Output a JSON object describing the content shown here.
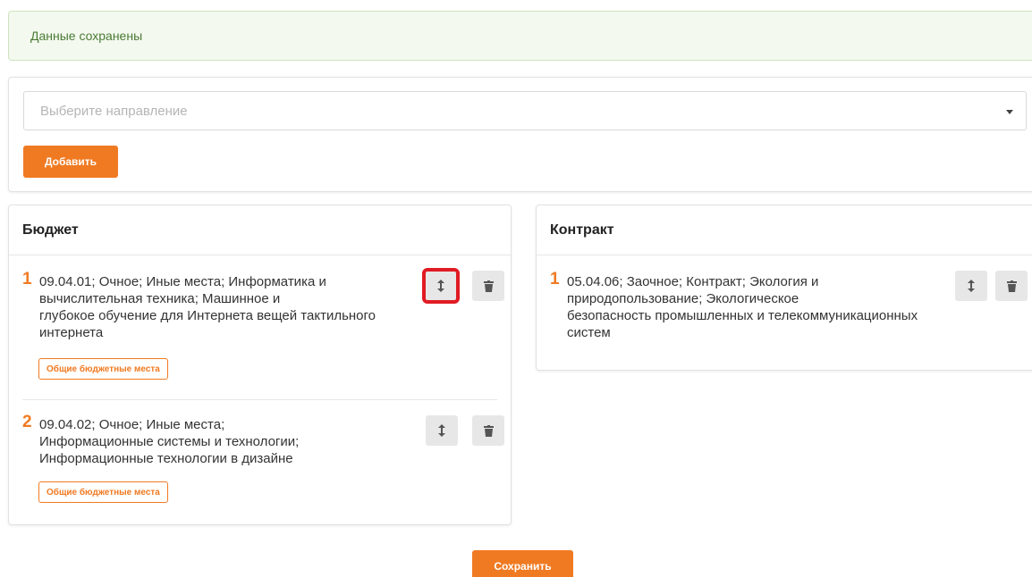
{
  "alert": {
    "text": "Данные сохранены"
  },
  "direction_select": {
    "placeholder": "Выберите направление"
  },
  "add_button": {
    "label": "Добавить"
  },
  "budget": {
    "title": "Бюджет",
    "items": [
      {
        "number": "1",
        "lines": [
          "09.04.01; Очное; Иные места; Информатика и",
          "вычислительная техника; Машинное и",
          "глубокое обучение для Интернета вещей тактильного",
          "интернета"
        ],
        "tag": "Общие бюджетные места"
      },
      {
        "number": "2",
        "lines": [
          "09.04.02; Очное; Иные места;",
          "Информационные системы и технологии;",
          "Информационные технологии в дизайне"
        ],
        "tag": "Общие бюджетные места"
      }
    ]
  },
  "contract": {
    "title": "Контракт",
    "items": [
      {
        "number": "1",
        "lines": [
          "05.04.06; Заочное; Контракт; Экология и",
          "природопользование; Экологическое",
          "безопасность промышленных и телекоммуникационных",
          "систем"
        ]
      }
    ]
  },
  "save_button": {
    "label": "Сохранить"
  },
  "icons": {
    "move": "vertical-arrows-icon",
    "delete": "trash-icon"
  },
  "colors": {
    "accent": "#f07a22",
    "success_bg": "#f3f9ee",
    "success_text": "#4a7a36",
    "highlight": "#e01b24"
  }
}
